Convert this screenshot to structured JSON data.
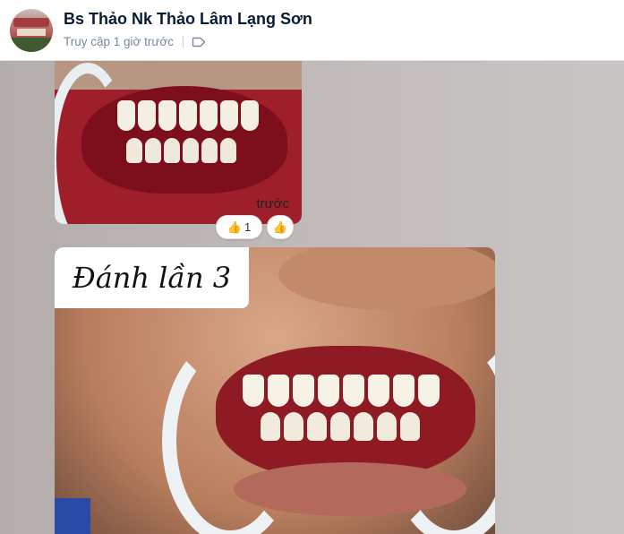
{
  "header": {
    "name": "Bs Thảo Nk Thảo Lâm Lạng Sơn",
    "status": "Truy cập 1 giờ trước"
  },
  "messages": [
    {
      "type": "image",
      "caption": "trước",
      "reactions": {
        "emoji": "👍",
        "count": "1",
        "add_emoji": "👍"
      }
    },
    {
      "type": "image",
      "overlay_text": "Đánh lần 3"
    }
  ],
  "icons": {
    "tag": "tag-icon",
    "avatar": "avatar"
  },
  "colors": {
    "title": "#081c36",
    "subtitle": "#7589a3",
    "chat_bg": "#bcb6b5"
  }
}
